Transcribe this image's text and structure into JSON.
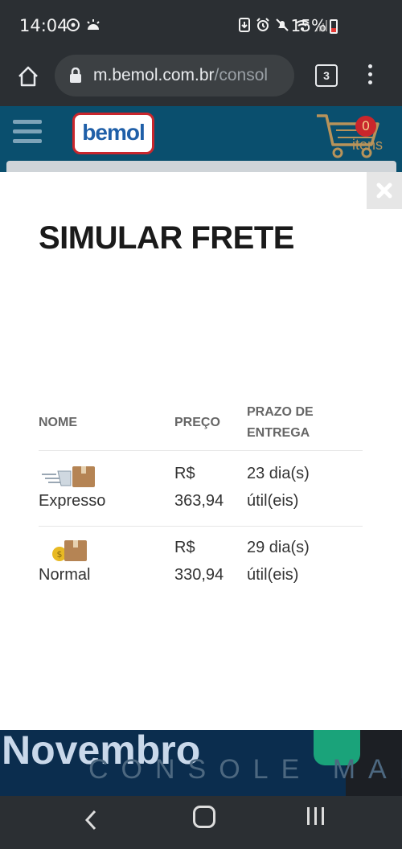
{
  "status_bar": {
    "time": "14:04",
    "battery": "15%",
    "icons_left": [
      "sync-icon",
      "weather-icon"
    ],
    "icons_right": [
      "download-icon",
      "alarm-icon",
      "mute-icon",
      "wifi-icon",
      "signal-icon"
    ]
  },
  "browser": {
    "url_domain": "m.bemol.com.br",
    "url_path": "/consol",
    "tab_count": "3"
  },
  "site": {
    "logo_text": "bemol",
    "cart_count": "0",
    "cart_label": "itens"
  },
  "modal": {
    "title": "SIMULAR FRETE",
    "columns": {
      "name": "NOME",
      "price": "PREÇO",
      "delivery_line1": "PRAZO DE",
      "delivery_line2": "ENTREGA"
    },
    "rows": [
      {
        "name": "Expresso",
        "price_line1": "R$",
        "price_line2": "363,94",
        "delivery_line1": "23 dia(s)",
        "delivery_line2": "útil(eis)",
        "icon": "express-delivery-icon"
      },
      {
        "name": "Normal",
        "price_line1": "R$",
        "price_line2": "330,94",
        "delivery_line1": "29 dia(s)",
        "delivery_line2": "útil(eis)",
        "icon": "normal-delivery-icon"
      }
    ]
  },
  "banner": {
    "text1": "Novembro",
    "text2": "CONSOLE MAIS"
  },
  "colors": {
    "header_blue": "#0a4f6e",
    "logo_red": "#c9262c",
    "logo_blue": "#1f5fa8",
    "system_bar": "#2b2f33"
  }
}
